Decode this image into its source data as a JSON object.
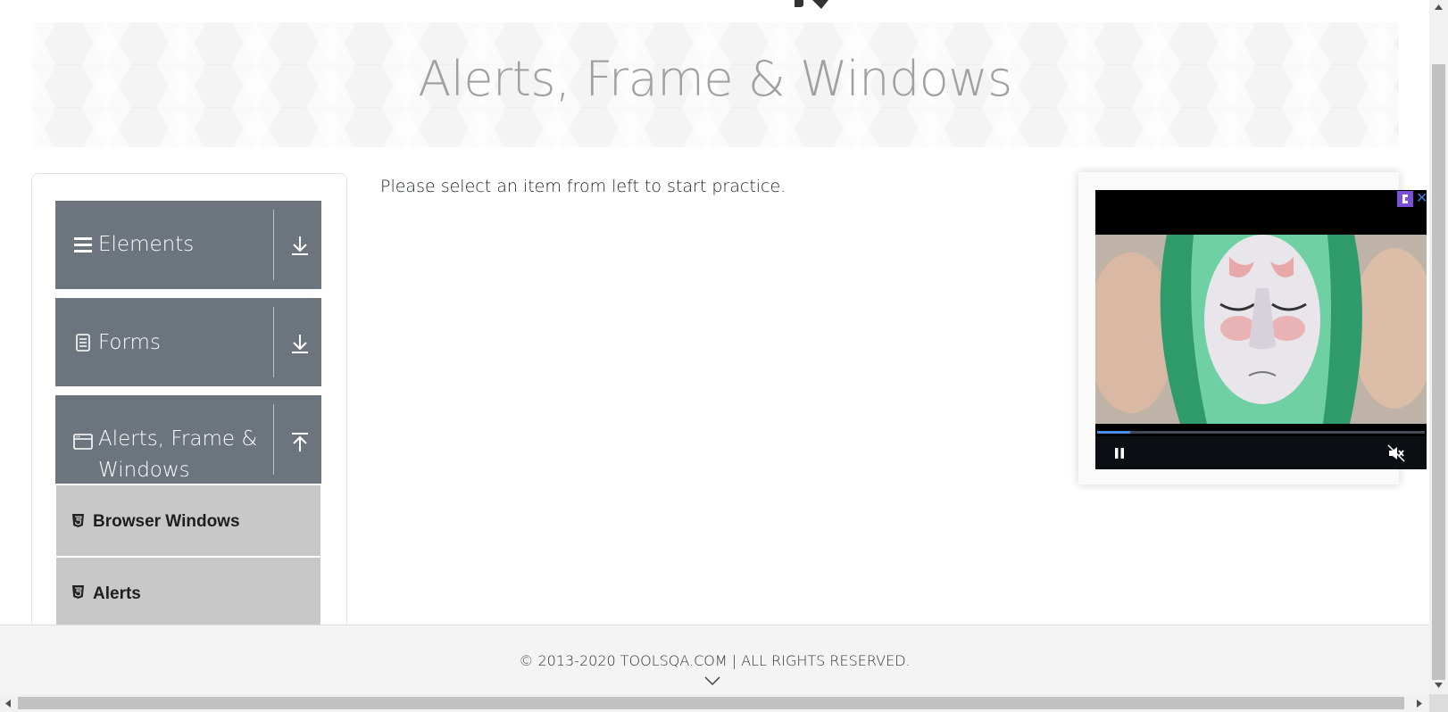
{
  "banner": {
    "title": "Alerts, Frame & Windows"
  },
  "sidebar": {
    "groups": [
      {
        "label": "Elements",
        "icon": "hamburger-icon",
        "state": "collapsed",
        "arrow": "download-arrow-icon"
      },
      {
        "label": "Forms",
        "icon": "document-icon",
        "state": "collapsed",
        "arrow": "download-arrow-icon"
      },
      {
        "label": "Alerts, Frame &",
        "label_line2": "Windows",
        "icon": "window-icon",
        "state": "expanded",
        "arrow": "upload-arrow-icon"
      }
    ],
    "sub_items": [
      {
        "label": "Browser Windows",
        "icon": "html5-icon"
      },
      {
        "label": "Alerts",
        "icon": "html5-icon"
      }
    ]
  },
  "main": {
    "instruction": "Please select an item from left to start practice."
  },
  "ad": {
    "progress": 0.1,
    "controls": [
      "pause-icon",
      "muted-speaker-icon"
    ],
    "close_glyph": "✕"
  },
  "footer": {
    "copyright": "© 2013-2020 TOOLSQA.COM | ALL RIGHTS RESERVED."
  },
  "colors": {
    "sidebar_header": "#6c757d",
    "sub_item": "#c8c8c8",
    "footer_bg": "#f4f4f4",
    "banner_text": "#a0a0a0"
  }
}
